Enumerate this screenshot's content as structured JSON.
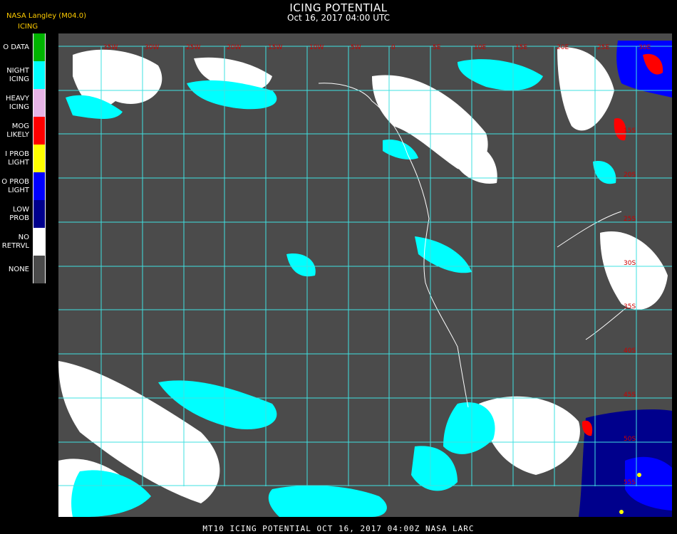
{
  "header": {
    "title": "ICING POTENTIAL",
    "subtitle": "Oct 16, 2017 04:00 UTC",
    "credit": "NASA Langley (M04.0)"
  },
  "legend": {
    "title": "ICING",
    "items": [
      {
        "label": "O DATA",
        "color": "#00b400"
      },
      {
        "label": "NIGHT\nICING",
        "color": "#00ffff"
      },
      {
        "label": "HEAVY\nICING",
        "color": "#e6b4e6"
      },
      {
        "label": "MOG\nLIKELY",
        "color": "#ff0000"
      },
      {
        "label": "I PROB\nLIGHT",
        "color": "#ffff00"
      },
      {
        "label": "O PROB\nLIGHT",
        "color": "#0000ff"
      },
      {
        "label": "LOW\nPROB",
        "color": "#00008c"
      },
      {
        "label": "NO\nRETRVL",
        "color": "#ffffff"
      },
      {
        "label": "NONE",
        "color": "#4b4b4b"
      }
    ]
  },
  "map": {
    "background_color": "#4b4b4b",
    "grid_color": "#3fe0e0",
    "label_color": "#cc0000",
    "longitude_labels": [
      "35W",
      "30W",
      "25W",
      "20W",
      "15W",
      "10W",
      "5W",
      "0",
      "5E",
      "10E",
      "15E",
      "20E",
      "25E",
      "30E",
      "35E"
    ],
    "latitude_labels": [
      "15S",
      "20S",
      "25S",
      "30S",
      "35S",
      "40S",
      "45S",
      "50S",
      "55S",
      "60S"
    ]
  },
  "footer": "MT10  ICING POTENTIAL   OCT 16, 2017 04:00Z   NASA LARC"
}
